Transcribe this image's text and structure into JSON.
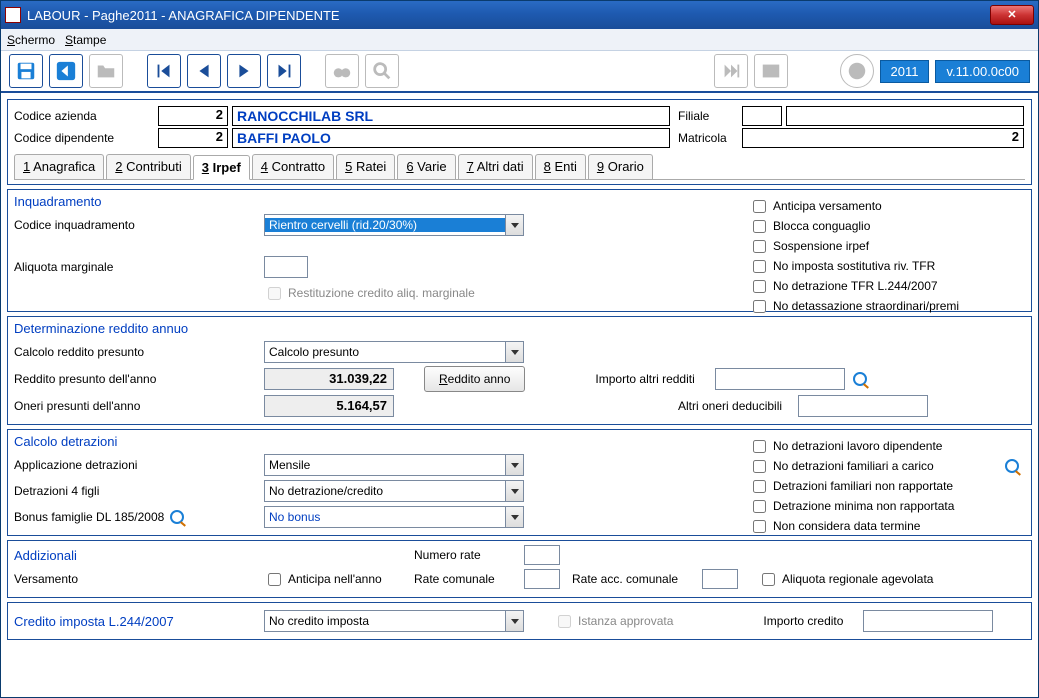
{
  "window": {
    "title": "LABOUR - Paghe2011 - ANAGRAFICA DIPENDENTE"
  },
  "menubar": {
    "schermo": "Schermo",
    "stampe": "Stampe"
  },
  "toolbar": {
    "year": "2011",
    "version": "v.11.00.0c00"
  },
  "header": {
    "codice_azienda_label": "Codice azienda",
    "codice_azienda_value": "2",
    "azienda_name": "RANOCCHILAB SRL",
    "filiale_label": "Filiale",
    "filiale_code": "",
    "filiale_name": "",
    "codice_dipendente_label": "Codice dipendente",
    "codice_dipendente_value": "2",
    "dipendente_name": "BAFFI PAOLO",
    "matricola_label": "Matricola",
    "matricola_value": "2"
  },
  "tabs": {
    "t1": "1 Anagrafica",
    "t2": "2 Contributi",
    "t3": "3 Irpef",
    "t4": "4 Contratto",
    "t5": "5 Ratei",
    "t6": "6 Varie",
    "t7": "7 Altri dati",
    "t8": "8 Enti",
    "t9": "9 Orario"
  },
  "inquadramento": {
    "title": "Inquadramento",
    "cod_inq_label": "Codice inquadramento",
    "cod_inq_value": "Rientro cervelli (rid.20/30%)",
    "aliquota_label": "Aliquota marginale",
    "restituzione": "Restituzione credito aliq. marginale",
    "chk_anticipa": "Anticipa versamento",
    "chk_blocca": "Blocca conguaglio",
    "chk_sosp": "Sospensione irpef",
    "chk_noimp": "No imposta sostitutiva riv. TFR",
    "chk_nodetr": "No detrazione TFR L.244/2007",
    "chk_nodet": "No detassazione straordinari/premi"
  },
  "determinazione": {
    "title": "Determinazione reddito annuo",
    "calcolo_label": "Calcolo reddito presunto",
    "calcolo_value": "Calcolo presunto",
    "reddito_label": "Reddito presunto dell'anno",
    "reddito_value": "31.039,22",
    "oneri_label": "Oneri presunti dell'anno",
    "oneri_value": "5.164,57",
    "btn_reddito": "Reddito anno",
    "importo_label": "Importo altri redditi",
    "altri_label": "Altri oneri deducibili"
  },
  "detrazioni": {
    "title": "Calcolo detrazioni",
    "applicazione_label": "Applicazione detrazioni",
    "applicazione_value": "Mensile",
    "detr4_label": "Detrazioni 4 figli",
    "detr4_value": "No detrazione/credito",
    "bonus_label": "Bonus famiglie DL 185/2008",
    "bonus_value": "No bonus",
    "chk_nodetrlavoro": "No detrazioni lavoro dipendente",
    "chk_nodetrfam": "No detrazioni familiari a carico",
    "chk_detrapp": "Detrazioni familiari non rapportate",
    "chk_detmin": "Detrazione minima non rapportata",
    "chk_nondata": "Non considera data termine"
  },
  "addizionali": {
    "title": "Addizionali",
    "versamento_label": "Versamento",
    "anticipa": "Anticipa nell'anno",
    "numrate_label": "Numero rate",
    "ratecom_label": "Rate comunale",
    "rateacc_label": "Rate acc. comunale",
    "aliquota_reg": "Aliquota regionale agevolata"
  },
  "credito": {
    "title": "Credito imposta L.244/2007",
    "select_value": "No credito imposta",
    "istanza": "Istanza approvata",
    "importo_label": "Importo credito"
  }
}
